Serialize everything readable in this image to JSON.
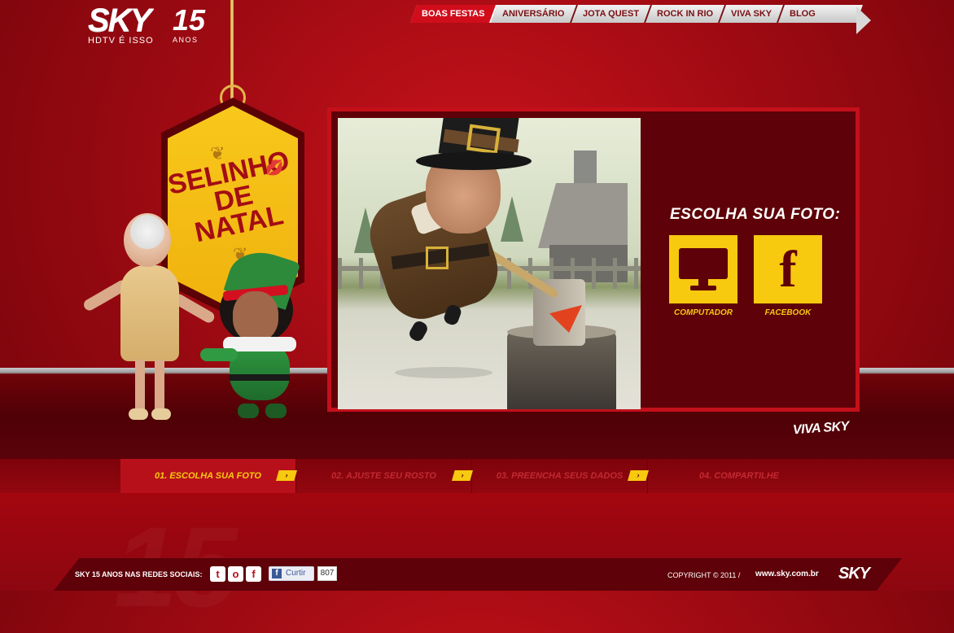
{
  "logo": {
    "brand": "SKY",
    "anniversary": "15",
    "tagline": "HDTV É ISSO",
    "anos": "ANOS"
  },
  "nav": {
    "items": [
      {
        "label": "BOAS FESTAS",
        "active": true
      },
      {
        "label": "ANIVERSÁRIO"
      },
      {
        "label": "JOTA QUEST"
      },
      {
        "label": "ROCK IN RIO"
      },
      {
        "label": "VIVA SKY"
      },
      {
        "label": "BLOG"
      }
    ]
  },
  "sign": {
    "line1": "SELINHO",
    "line2": "DE NATAL"
  },
  "panel": {
    "title": "ESCOLHA SUA FOTO:",
    "options": [
      {
        "label": "COMPUTADOR",
        "icon": "monitor-icon"
      },
      {
        "label": "FACEBOOK",
        "icon": "facebook-icon"
      }
    ]
  },
  "viva_sky": "VIVA SKY",
  "steps": [
    {
      "label": "01. ESCOLHA SUA FOTO",
      "active": true
    },
    {
      "label": "02. AJUSTE SEU ROSTO"
    },
    {
      "label": "03. PREENCHA SEUS DADOS"
    },
    {
      "label": "04. COMPARTILHE"
    }
  ],
  "footer": {
    "social_label": "SKY 15 ANOS NAS REDES SOCIAIS:",
    "social_icons": [
      "twitter-icon",
      "orkut-icon",
      "facebook-icon"
    ],
    "curtir": "Curtir",
    "curtir_count": "807",
    "copyright": "COPYRIGHT © 2011   /",
    "url": "www.sky.com.br",
    "brand": "SKY"
  },
  "colors": {
    "brand_red": "#c4101a",
    "accent_yellow": "#f7c90f",
    "panel_dark": "#5e0108"
  }
}
